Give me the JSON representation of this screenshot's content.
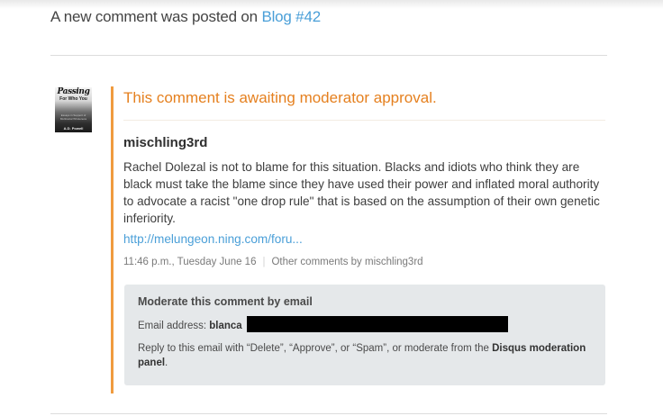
{
  "header": {
    "prefix": "A new comment was posted on",
    "link": "Blog #42"
  },
  "comment": {
    "status": "This comment is awaiting moderator approval.",
    "author": "mischling3rd",
    "text": "Rachel Dolezal is not to blame for this situation. Blacks and idiots who think they are black must take the blame since they have used their power and inflated moral authority to advocate a racist \"one drop rule\" that is based on the assumption of their own genetic inferiority.",
    "link": "http://melungeon.ning.com/foru...",
    "timestamp": "11:46 p.m., Tuesday June 16",
    "other_comments": "Other comments by mischling3rd"
  },
  "avatar": {
    "title": "Passing",
    "subtitle": "For Who You",
    "small_text": "Essays in Support of Multiracial Wholeness",
    "author": "A.D. Powell"
  },
  "moderation": {
    "title": "Moderate this comment by email",
    "email_label": "Email address:",
    "email_value": "blanca",
    "reply_prefix": "Reply to this email with “Delete”, “Approve”, or “Spam”, or moderate from the",
    "panel_link": "Disqus moderation panel",
    "reply_suffix": "."
  },
  "colors": {
    "accent_orange": "#e5801f",
    "link_blue": "#4a9fd8",
    "mod_box_bg": "#e5e8ea",
    "left_bar": "#f09b3f"
  }
}
